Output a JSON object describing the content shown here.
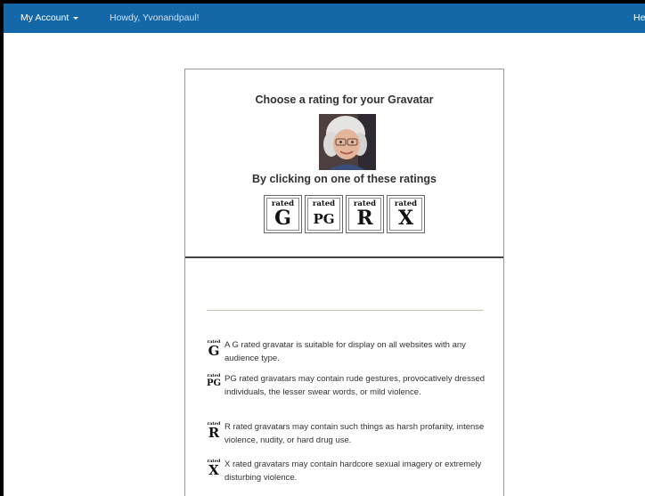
{
  "topbar": {
    "account_label": "My Account",
    "greeting": "Howdy, Yvonandpaul!",
    "help_label": "He"
  },
  "card": {
    "title": "Choose a rating for your Gravatar",
    "subtitle": "By clicking on one of these ratings",
    "ratings": [
      {
        "small": "rated",
        "big": "G"
      },
      {
        "small": "rated",
        "big": "PG"
      },
      {
        "small": "rated",
        "big": "R"
      },
      {
        "small": "rated",
        "big": "X"
      }
    ],
    "descriptions": [
      {
        "small": "rated",
        "big": "G",
        "text": "A G rated gravatar is suitable for display on all websites with any audience type."
      },
      {
        "small": "rated",
        "big": "PG",
        "text": "PG rated gravatars may contain rude gestures, provocatively dressed individuals, the lesser swear words, or mild violence."
      },
      {
        "small": "rated",
        "big": "R",
        "text": "R rated gravatars may contain such things as harsh profanity, intense violence, nudity, or hard drug use."
      },
      {
        "small": "rated",
        "big": "X",
        "text": "X rated gravatars may contain hardcore sexual imagery or extremely disturbing violence."
      }
    ]
  },
  "colors": {
    "topbar_bg": "#1568a8",
    "topbar_text": "#ffffff",
    "border": "#999999"
  }
}
